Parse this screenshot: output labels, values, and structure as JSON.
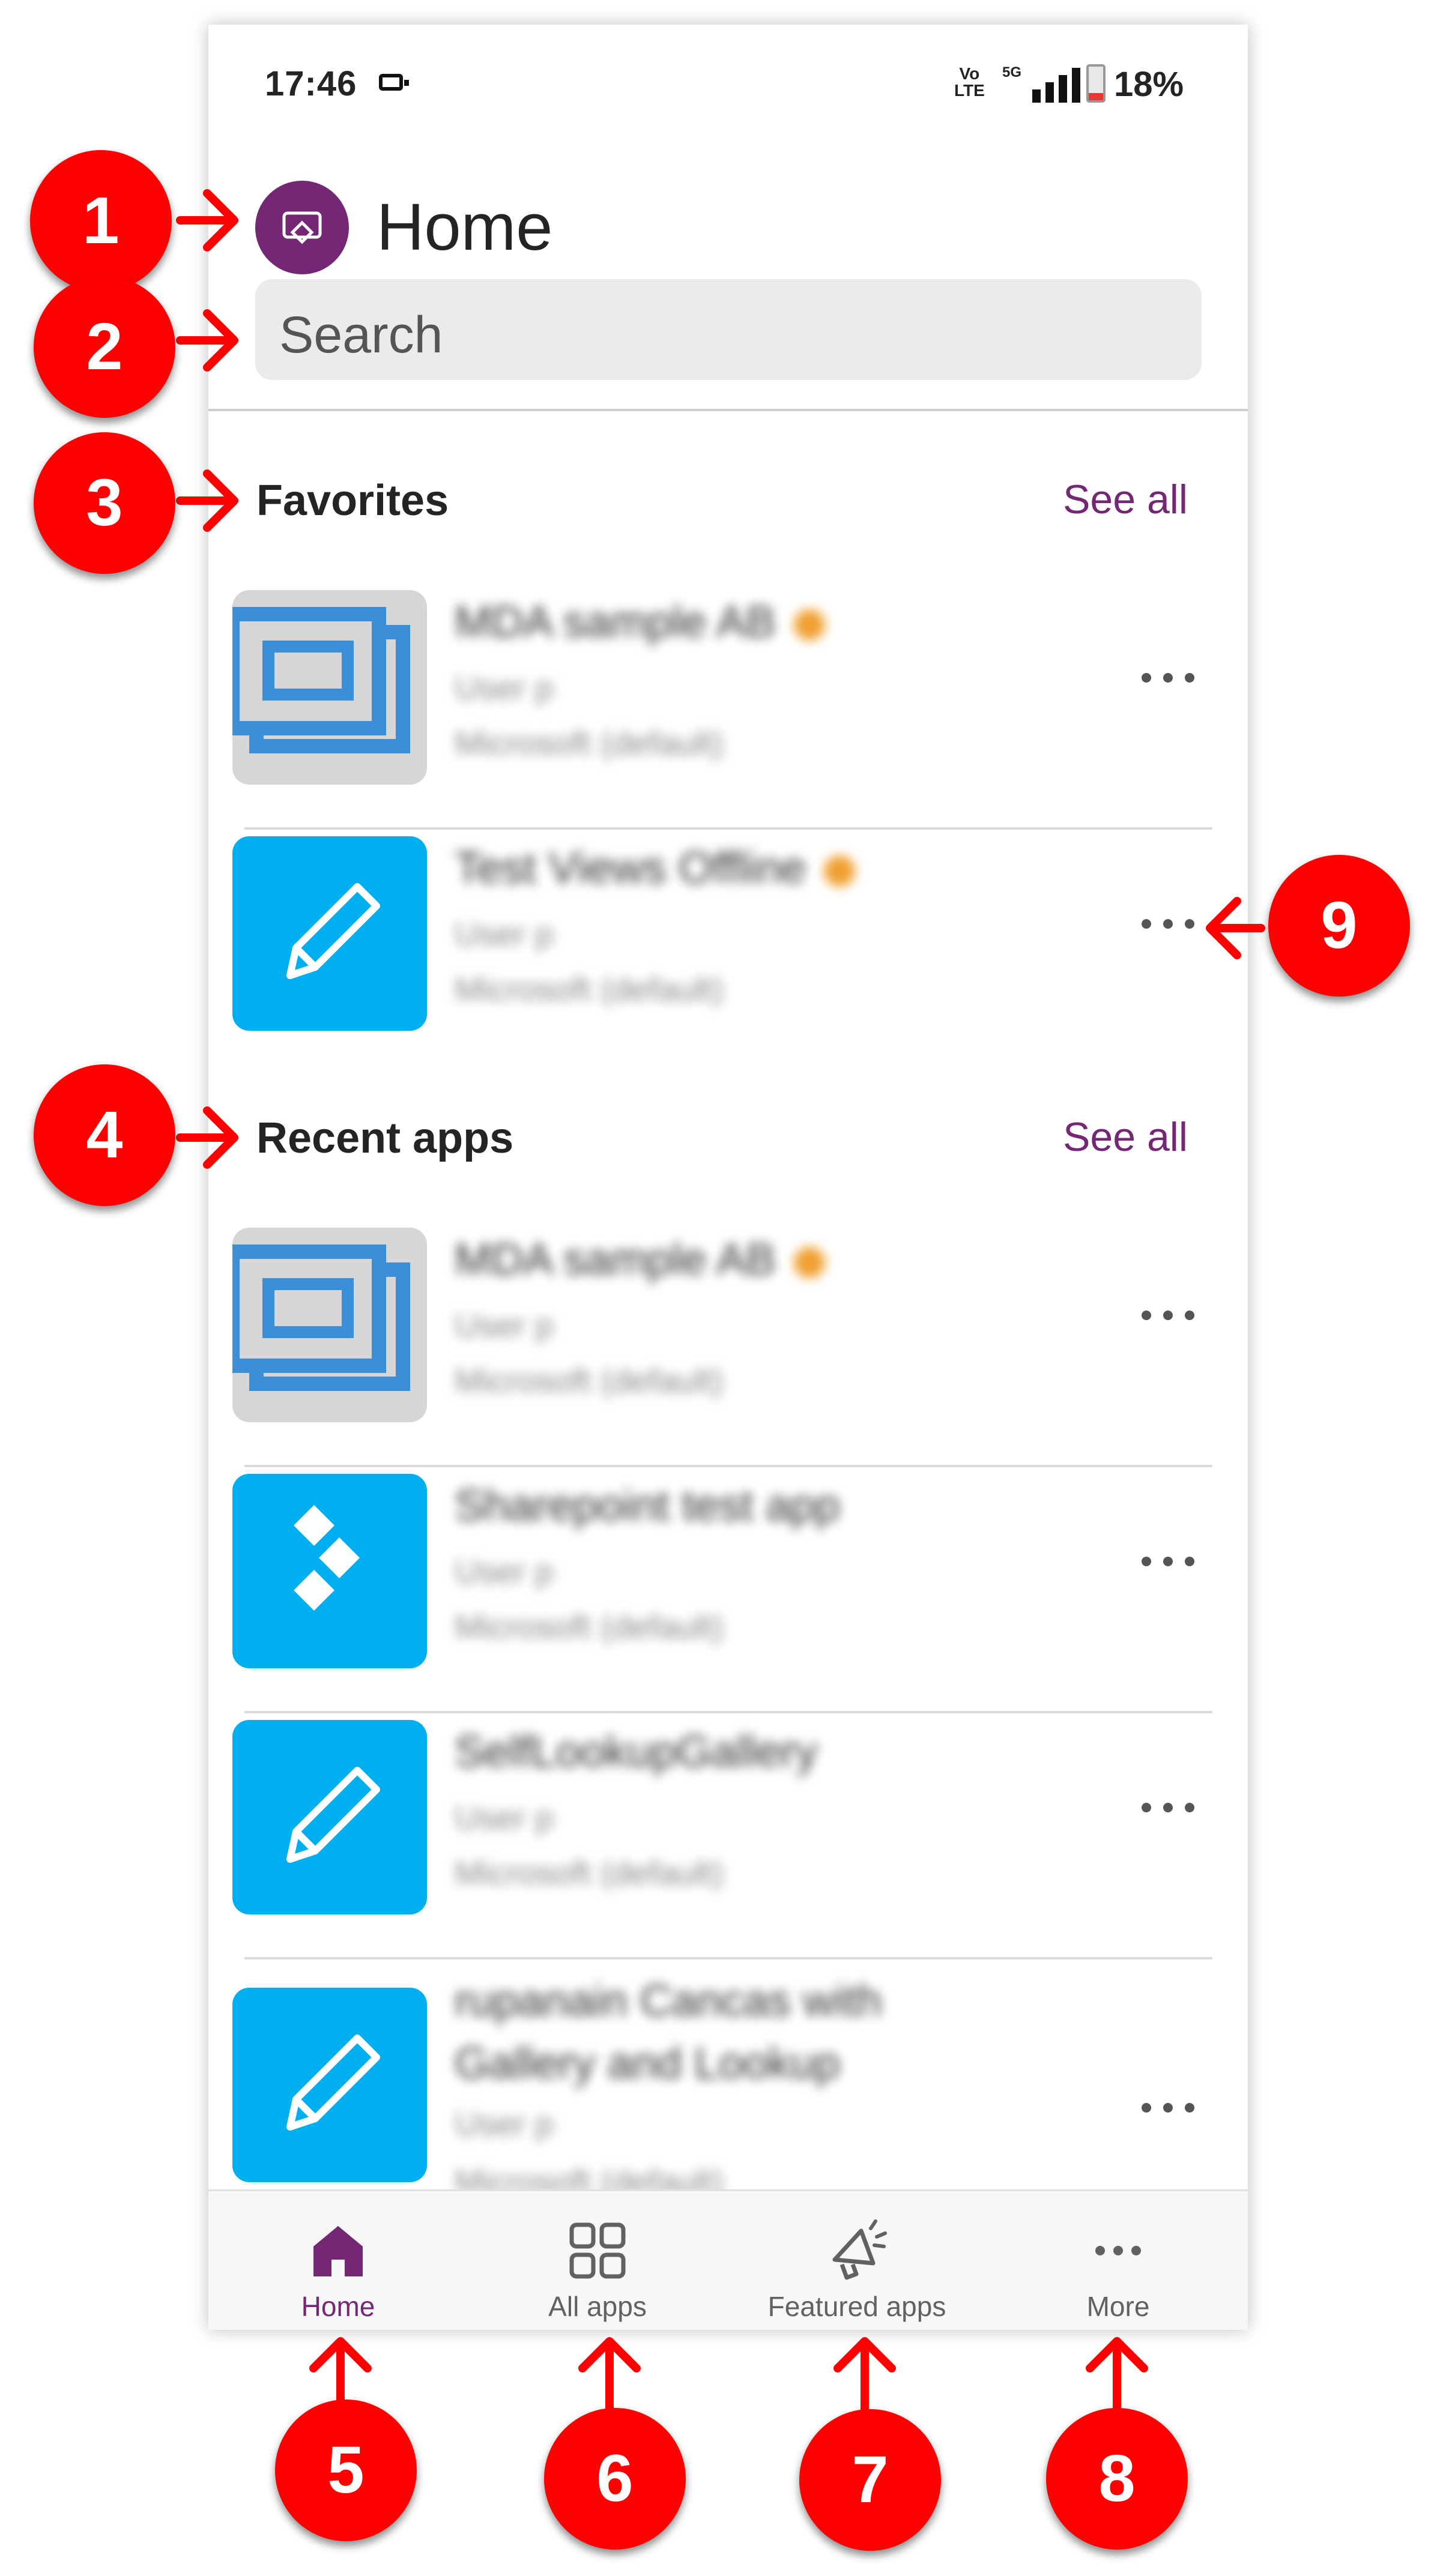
{
  "status_bar": {
    "time": "17:46",
    "volte_top": "Vo",
    "volte_bottom": "LTE",
    "network": "5G",
    "battery": "18%"
  },
  "header": {
    "title": "Home",
    "app_icon": "power-apps-logo"
  },
  "search": {
    "placeholder": "Search"
  },
  "favorites": {
    "title": "Favorites",
    "see_all": "See all",
    "items": [
      {
        "name": "MDA sample AB",
        "owner": "User p",
        "env": "Microsoft (default)",
        "icon": "model-app-icon",
        "favorite": true
      },
      {
        "name": "Test Views Offline",
        "owner": "User p",
        "env": "Microsoft (default)",
        "icon": "pencil-icon",
        "favorite": true
      }
    ]
  },
  "recent": {
    "title": "Recent apps",
    "see_all": "See all",
    "items": [
      {
        "name": "MDA sample AB",
        "owner": "User p",
        "env": "Microsoft (default)",
        "icon": "model-app-icon",
        "favorite": true
      },
      {
        "name": "Sharepoint test app",
        "owner": "User p",
        "env": "Microsoft (default)",
        "icon": "sharepoint-icon",
        "favorite": false
      },
      {
        "name": "SelfLookupGallery",
        "owner": "User p",
        "env": "Microsoft (default)",
        "icon": "pencil-icon",
        "favorite": false
      },
      {
        "name": "rupanain Cancas with Gallery and Lookup",
        "owner": "User p",
        "env": "Microsoft (default)",
        "icon": "pencil-icon",
        "favorite": false
      }
    ]
  },
  "nav": {
    "items": [
      {
        "label": "Home",
        "icon": "home-icon",
        "active": true
      },
      {
        "label": "All apps",
        "icon": "grid-icon",
        "active": false
      },
      {
        "label": "Featured apps",
        "icon": "megaphone-icon",
        "active": false
      },
      {
        "label": "More",
        "icon": "more-icon",
        "active": false
      }
    ]
  },
  "annotations": [
    "1",
    "2",
    "3",
    "4",
    "5",
    "6",
    "7",
    "8",
    "9"
  ],
  "colors": {
    "accent": "#742774",
    "tile_blue": "#00aff0",
    "marker_red": "#ff0000"
  }
}
